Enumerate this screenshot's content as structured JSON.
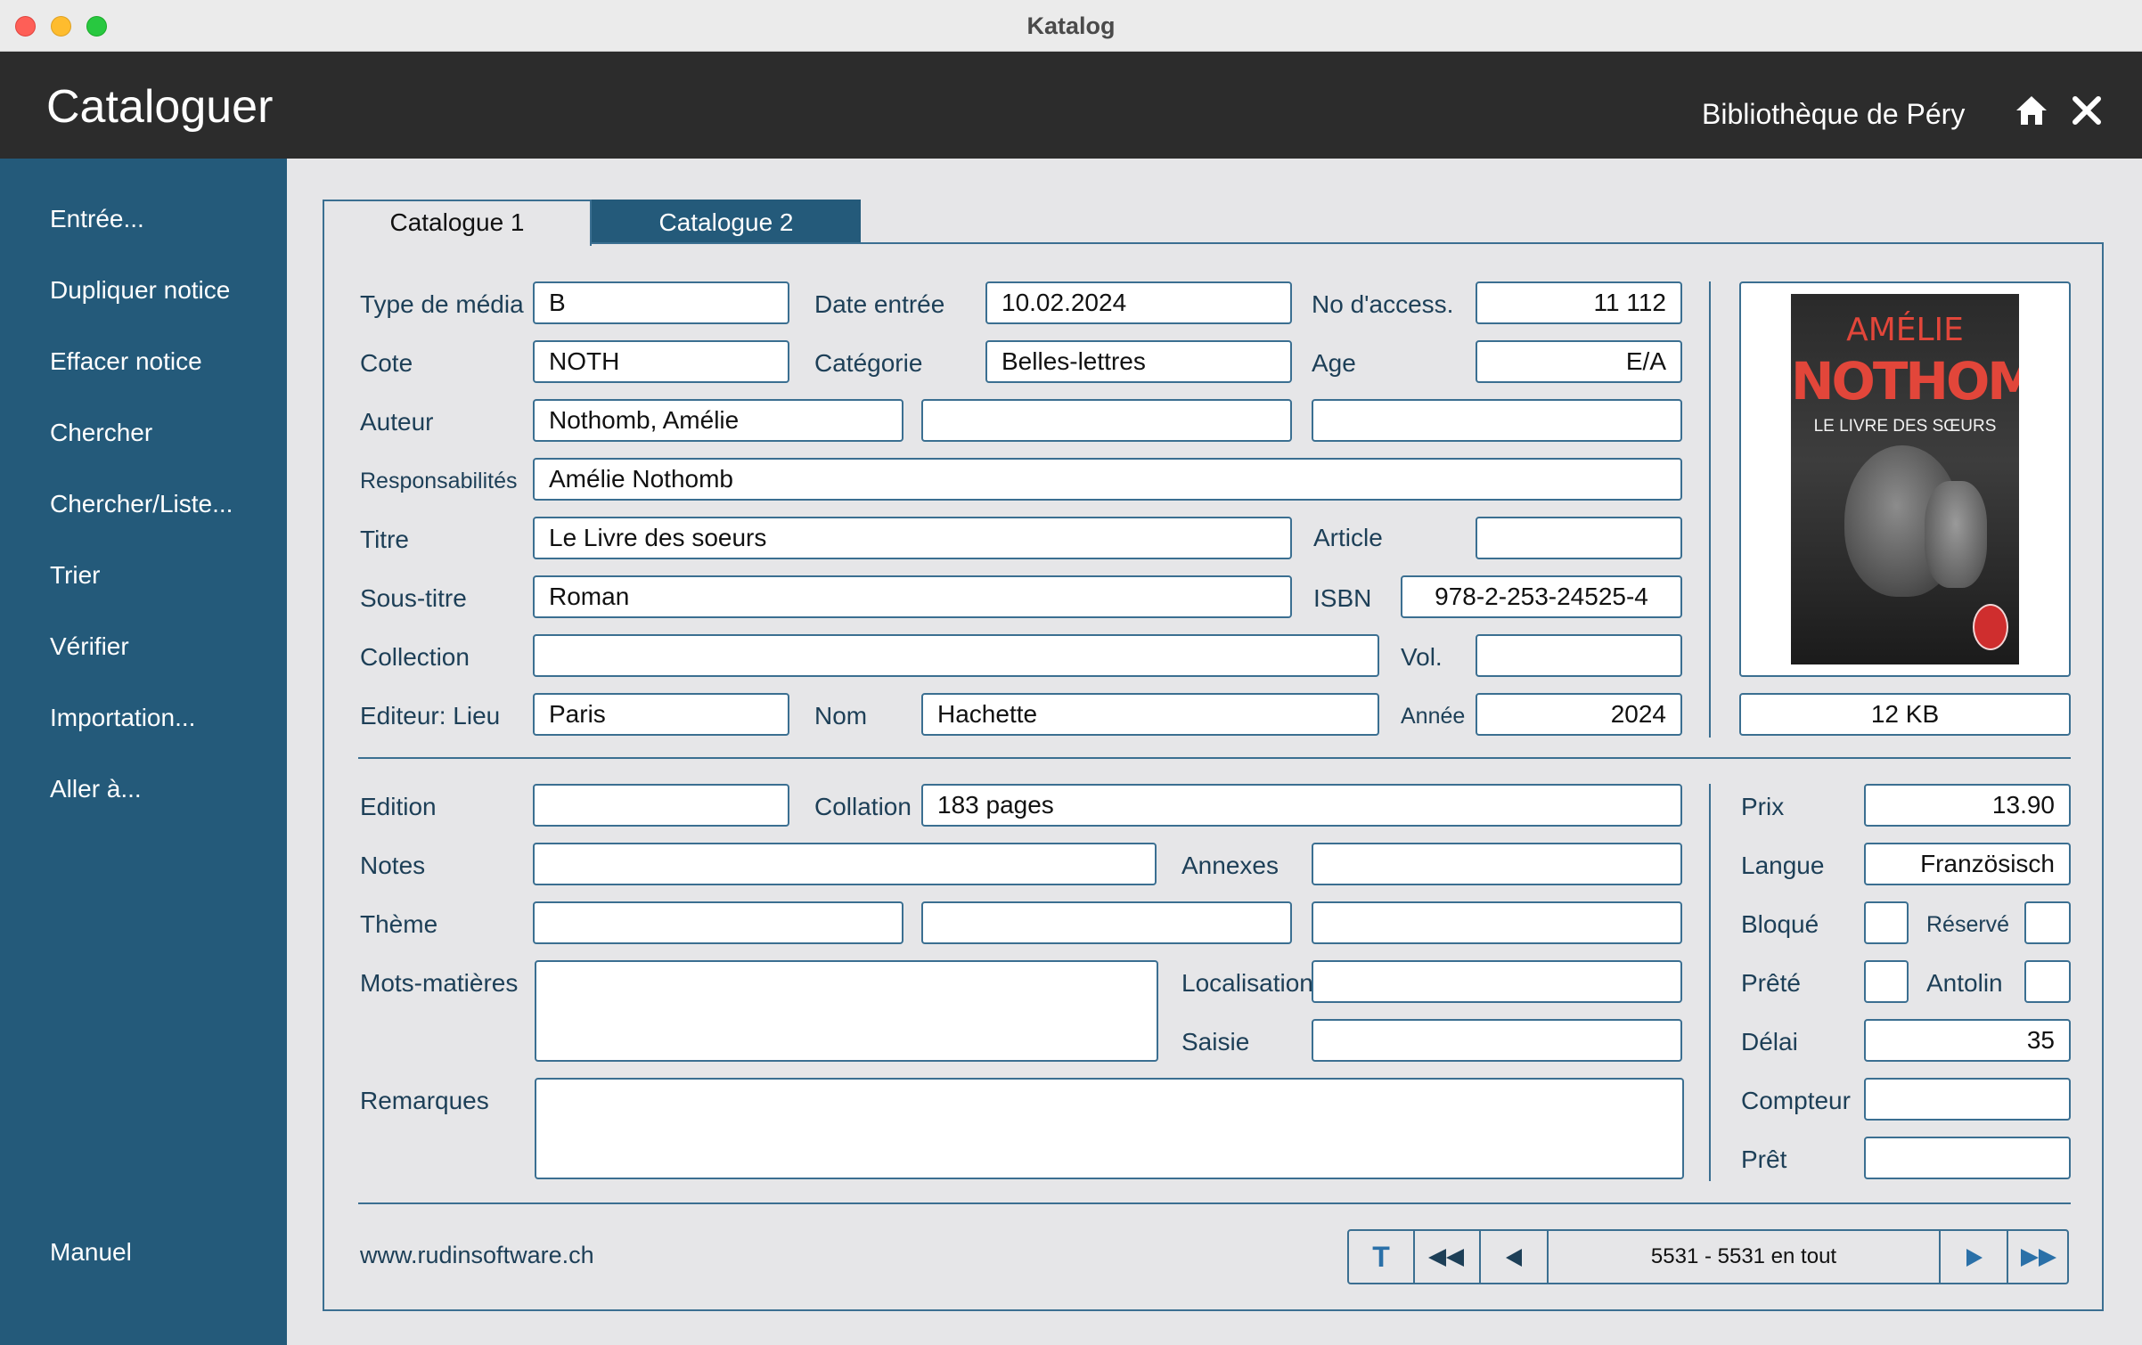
{
  "window": {
    "title": "Katalog"
  },
  "header": {
    "title": "Cataloguer",
    "library": "Bibliothèque de Péry"
  },
  "sidebar": {
    "items": [
      {
        "label": "Entrée..."
      },
      {
        "label": "Dupliquer notice"
      },
      {
        "label": "Effacer notice"
      },
      {
        "label": "Chercher"
      },
      {
        "label": "Chercher/Liste..."
      },
      {
        "label": "Trier"
      },
      {
        "label": "Vérifier"
      },
      {
        "label": "Importation..."
      },
      {
        "label": "Aller à..."
      }
    ],
    "manual": "Manuel"
  },
  "tabs": [
    {
      "label": "Catalogue 1",
      "active": true
    },
    {
      "label": "Catalogue 2",
      "active": false
    }
  ],
  "labels": {
    "type_media": "Type de média",
    "date_entree": "Date entrée",
    "no_access": "No d'access.",
    "cote": "Cote",
    "categorie": "Catégorie",
    "age": "Age",
    "auteur": "Auteur",
    "responsabilites": "Responsabilités",
    "titre": "Titre",
    "article": "Article",
    "sous_titre": "Sous-titre",
    "isbn": "ISBN",
    "collection": "Collection",
    "vol": "Vol.",
    "editeur_lieu": "Editeur: Lieu",
    "nom": "Nom",
    "annee": "Année",
    "edition": "Edition",
    "collation": "Collation",
    "notes": "Notes",
    "annexes": "Annexes",
    "theme": "Thème",
    "mots_matieres": "Mots-matières",
    "localisation": "Localisation",
    "saisie": "Saisie",
    "remarques": "Remarques",
    "prix": "Prix",
    "langue": "Langue",
    "bloque": "Bloqué",
    "reserve": "Réservé",
    "prete": "Prêté",
    "antolin": "Antolin",
    "delai": "Délai",
    "compteur": "Compteur",
    "pret": "Prêt"
  },
  "record": {
    "type_media": "B",
    "date_entree": "10.02.2024",
    "no_access": "11 112",
    "cote": "NOTH",
    "categorie": "Belles-lettres",
    "age": "E/A",
    "auteur": "Nothomb, Amélie",
    "auteur2": "",
    "auteur3": "",
    "responsabilites": "Amélie Nothomb",
    "titre": "Le Livre des soeurs",
    "article": "",
    "sous_titre": "Roman",
    "isbn": "978-2-253-24525-4",
    "collection": "",
    "vol": "",
    "editeur_lieu": "Paris",
    "editeur_nom": "Hachette",
    "annee": "2024",
    "image_size": "12 KB",
    "edition": "",
    "collation": "183 pages",
    "notes": "",
    "annexes": "",
    "theme1": "",
    "theme2": "",
    "theme3": "",
    "mots_matieres": "",
    "localisation": "",
    "saisie": "",
    "remarques": "",
    "prix": "13.90",
    "langue": "Französisch",
    "bloque": false,
    "reserve": false,
    "prete": false,
    "antolin": false,
    "delai": "35",
    "compteur": "",
    "pret": ""
  },
  "cover": {
    "author_first": "AMÉLIE",
    "author_last": "NOTHOMB",
    "title": "LE LIVRE DES SŒURS"
  },
  "footer": {
    "website": "www.rudinsoftware.ch",
    "record_status": "5531 - 5531 en tout",
    "nav": {
      "text_button": "T"
    }
  },
  "colors": {
    "sidebar": "#245a7a",
    "header": "#2c2c2c",
    "border": "#3b6f91",
    "link": "#2a70a8"
  }
}
